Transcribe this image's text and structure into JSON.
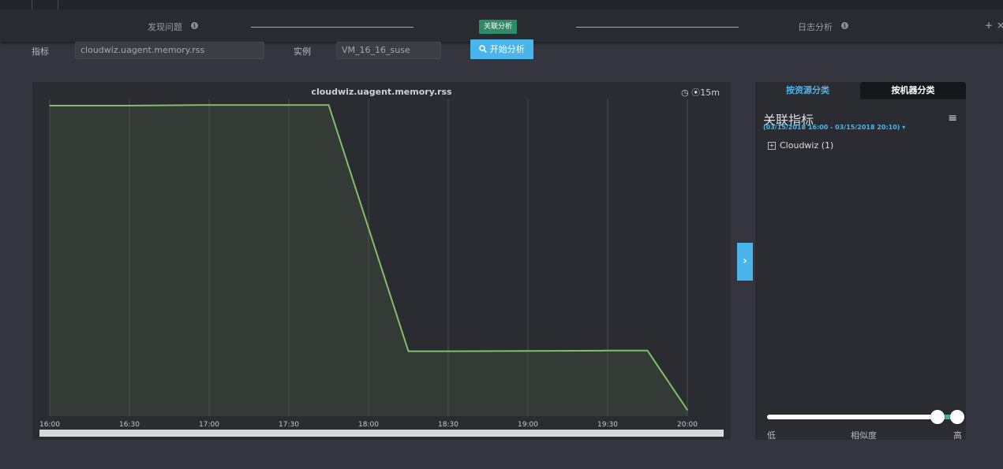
{
  "steps": {
    "step1": "发现问题",
    "step2": "关联分析",
    "step3": "日志分析",
    "info_icon": "info-circle-icon"
  },
  "window_controls": {
    "add": "+",
    "close": "×"
  },
  "form": {
    "metric_label": "指标",
    "metric_value": "cloudwiz.uagent.memory.rss",
    "instance_label": "实例",
    "instance_value": "VM_16_16_suse",
    "start_button": "开始分析",
    "start_icon": "search-icon"
  },
  "chart": {
    "toolbar_clock_icon": "clock-icon",
    "toolbar_interval": "15m"
  },
  "chart_data": {
    "type": "area",
    "title": "cloudwiz.uagent.memory.rss",
    "xlabel": "",
    "ylabel": "",
    "x": [
      "16:00",
      "16:05",
      "16:30",
      "17:00",
      "17:30",
      "17:45",
      "18:15",
      "18:30",
      "19:00",
      "19:30",
      "19:45",
      "20:00"
    ],
    "values": [
      98,
      98,
      98,
      98.2,
      98.2,
      98.2,
      20.5,
      20.5,
      20.6,
      20.7,
      20.7,
      2
    ],
    "xticks": [
      "16:00",
      "16:30",
      "17:00",
      "17:30",
      "18:00",
      "18:30",
      "19:00",
      "19:30",
      "20:00"
    ],
    "ylim": [
      0,
      100
    ],
    "grid": "vertical",
    "line_color": "#7fc06a",
    "fill_color": "#343a36"
  },
  "sidebar": {
    "tab_resource": "按资源分类",
    "tab_machine": "按机器分类",
    "title": "关联指标",
    "range": "(03/15/2018 16:00 - 03/15/2018 20:10)",
    "range_caret": "▾",
    "menu_icon": "menu-icon",
    "tree_item": "Cloudwiz (1)",
    "tree_expand": "+",
    "slider_low": "低",
    "slider_mid": "相似度",
    "slider_high": "高",
    "slider_range": [
      0.9,
      1.0
    ]
  },
  "colors": {
    "accent": "#4ab5ea",
    "active_step": "#2f8a66",
    "background": "#34353f",
    "panel": "#2b2c32"
  }
}
